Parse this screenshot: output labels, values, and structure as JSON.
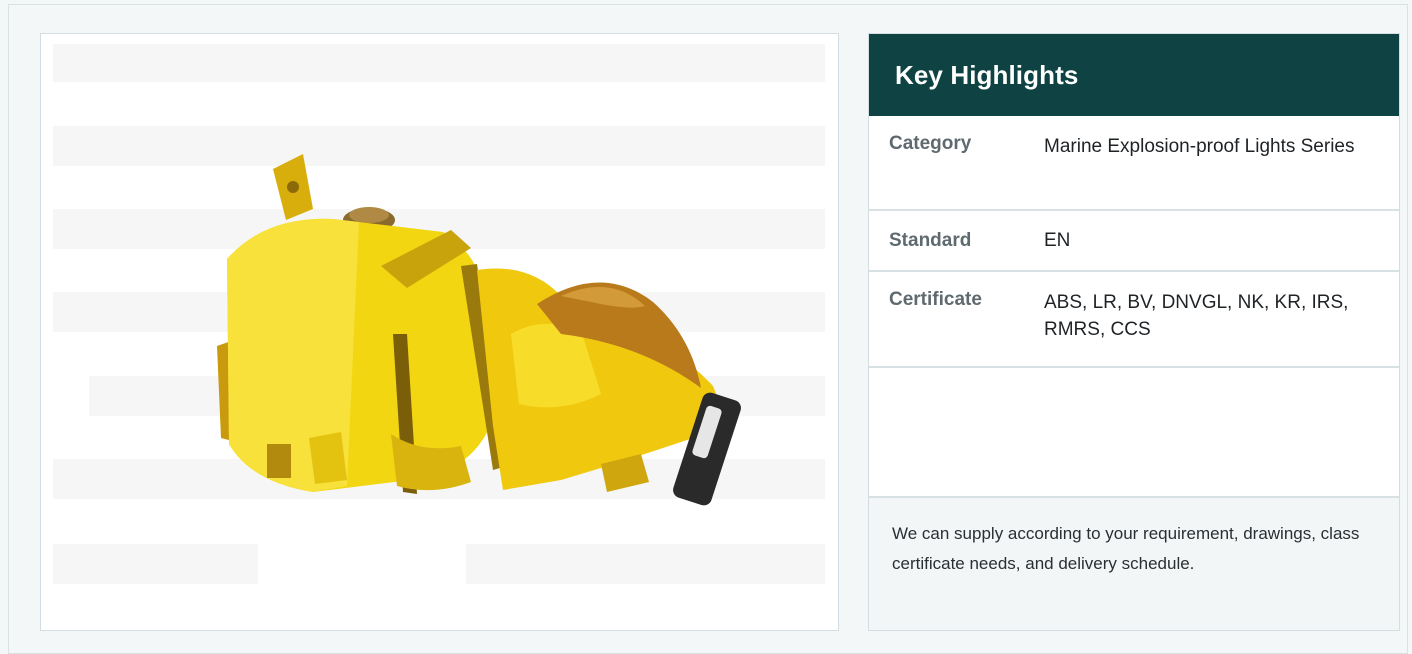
{
  "image": {
    "alt": "",
    "icon": "product-photo-explosion-proof-light"
  },
  "highlights": {
    "title": "Key Highlights",
    "rows": [
      {
        "key": "Category",
        "value": "Marine Explosion-proof Lights Series"
      },
      {
        "key": "Standard",
        "value": "EN"
      },
      {
        "key": "Certificate",
        "value": "ABS, LR, BV, DNVGL, NK, KR, IRS, RMRS, CCS"
      },
      {
        "key": "",
        "value": ""
      }
    ],
    "note": "We can supply according to your requirement, drawings, class certificate needs, and delivery schedule."
  },
  "colors": {
    "header_bg": "#0f4242",
    "product_yellow": "#f4dd12",
    "panel_bg": "#f4f7f8"
  }
}
